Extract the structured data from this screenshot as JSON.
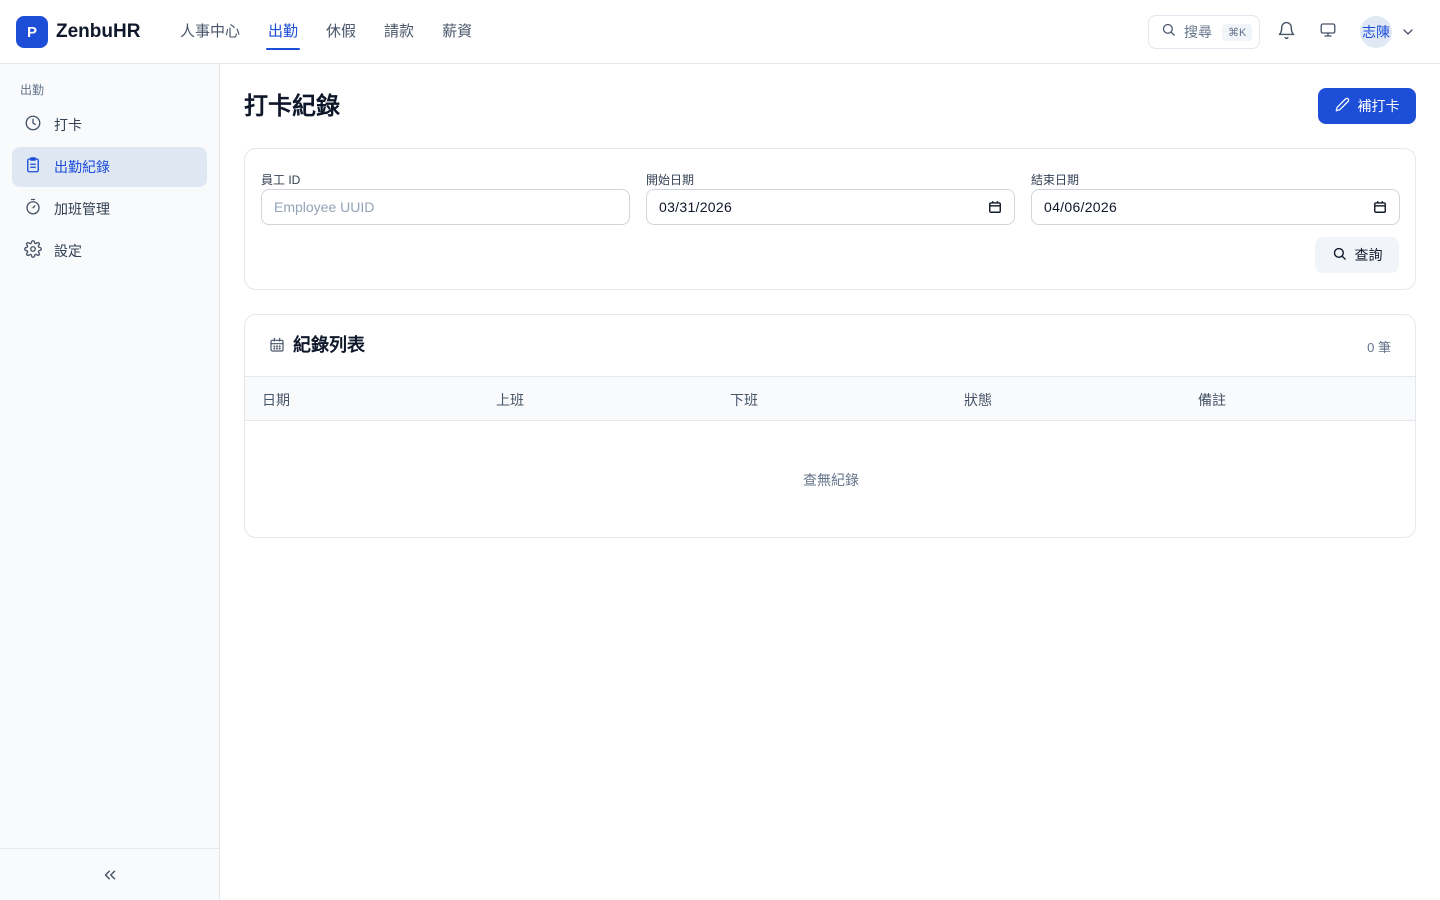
{
  "app": {
    "logo_letter": "P",
    "name": "ZenbuHR"
  },
  "top_nav": [
    {
      "label": "人事中心"
    },
    {
      "label": "出勤"
    },
    {
      "label": "休假"
    },
    {
      "label": "請款"
    },
    {
      "label": "薪資"
    }
  ],
  "top_nav_active_index": 1,
  "search": {
    "label": "搜尋",
    "shortcut": "⌘K",
    "icon": "search-icon"
  },
  "header_icons": [
    "bell-icon",
    "monitor-icon"
  ],
  "user": {
    "avatar_text": "志陳"
  },
  "sidebar": {
    "section": "出勤",
    "items": [
      {
        "label": "打卡",
        "icon": "clock-icon"
      },
      {
        "label": "出勤紀錄",
        "icon": "clipboard-icon",
        "active": true
      },
      {
        "label": "加班管理",
        "icon": "stopwatch-icon"
      },
      {
        "label": "設定",
        "icon": "gear-icon"
      }
    ],
    "collapse_icon": "chevrons-left-icon"
  },
  "page": {
    "title": "打卡紀錄",
    "primary_button": "補打卡"
  },
  "filters": {
    "employee": {
      "label": "員工 ID",
      "placeholder": "Employee UUID",
      "value": ""
    },
    "start_date": {
      "label": "開始日期",
      "value": "03/31/2026"
    },
    "end_date": {
      "label": "結束日期",
      "value": "04/06/2026"
    },
    "query_button": "查詢"
  },
  "records": {
    "title": "紀錄列表",
    "count": "0 筆",
    "columns": [
      "日期",
      "上班",
      "下班",
      "狀態",
      "備註"
    ],
    "rows": [],
    "empty_text": "查無紀錄"
  },
  "colors": {
    "accent": "#1d4ed8",
    "sidebar_bg": "#f8fafc",
    "active_item_bg": "#dfe7f3",
    "border": "#e5e7eb"
  }
}
